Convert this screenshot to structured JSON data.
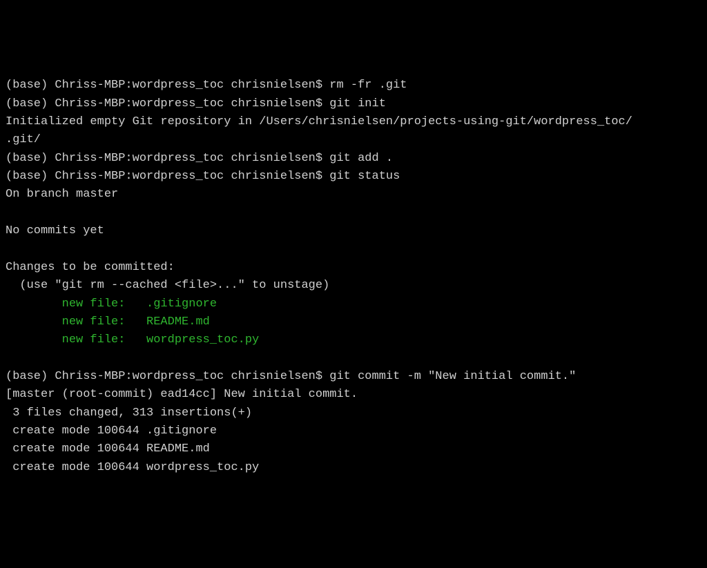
{
  "terminal": {
    "lines": [
      {
        "type": "prompt",
        "prompt": "(base) Chriss-MBP:wordpress_toc chrisnielsen$ ",
        "command": "rm -fr .git"
      },
      {
        "type": "prompt",
        "prompt": "(base) Chriss-MBP:wordpress_toc chrisnielsen$ ",
        "command": "git init"
      },
      {
        "type": "output",
        "text": "Initialized empty Git repository in /Users/chrisnielsen/projects-using-git/wordpress_toc/"
      },
      {
        "type": "output",
        "text": ".git/"
      },
      {
        "type": "prompt",
        "prompt": "(base) Chriss-MBP:wordpress_toc chrisnielsen$ ",
        "command": "git add ."
      },
      {
        "type": "prompt",
        "prompt": "(base) Chriss-MBP:wordpress_toc chrisnielsen$ ",
        "command": "git status"
      },
      {
        "type": "output",
        "text": "On branch master"
      },
      {
        "type": "output",
        "text": ""
      },
      {
        "type": "output",
        "text": "No commits yet"
      },
      {
        "type": "output",
        "text": ""
      },
      {
        "type": "output",
        "text": "Changes to be committed:"
      },
      {
        "type": "output",
        "text": "  (use \"git rm --cached <file>...\" to unstage)"
      },
      {
        "type": "green",
        "text": "        new file:   .gitignore"
      },
      {
        "type": "green",
        "text": "        new file:   README.md"
      },
      {
        "type": "green",
        "text": "        new file:   wordpress_toc.py"
      },
      {
        "type": "output",
        "text": ""
      },
      {
        "type": "prompt",
        "prompt": "(base) Chriss-MBP:wordpress_toc chrisnielsen$ ",
        "command": "git commit -m \"New initial commit.\""
      },
      {
        "type": "output",
        "text": "[master (root-commit) ead14cc] New initial commit."
      },
      {
        "type": "output",
        "text": " 3 files changed, 313 insertions(+)"
      },
      {
        "type": "output",
        "text": " create mode 100644 .gitignore"
      },
      {
        "type": "output",
        "text": " create mode 100644 README.md"
      },
      {
        "type": "output",
        "text": " create mode 100644 wordpress_toc.py"
      }
    ]
  }
}
